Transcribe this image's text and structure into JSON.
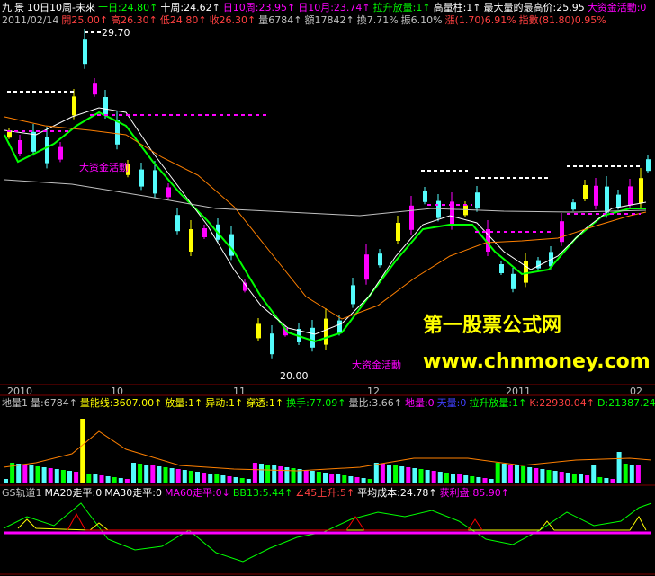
{
  "header": {
    "row1": [
      {
        "text": "九",
        "color": "#ffffff"
      },
      {
        "text": "景",
        "color": "#ffffff"
      },
      {
        "text": "10日10周-未來",
        "color": "#ffffff"
      },
      {
        "text": "十日:24.80↑",
        "color": "#00ff00"
      },
      {
        "text": "十周:24.62↑",
        "color": "#ffffff"
      },
      {
        "text": "日10周:23.95↑",
        "color": "#ff00ff"
      },
      {
        "text": "日10月:23.74↑",
        "color": "#ff00ff"
      },
      {
        "text": "拉升放量:1↑",
        "color": "#00ff00"
      },
      {
        "text": "高量柱:1↑",
        "color": "#ffffff"
      },
      {
        "text": "最大量的最高价:25.95",
        "color": "#ffffff"
      },
      {
        "text": "大资金活動:0",
        "color": "#ff00ff"
      }
    ],
    "row2": [
      {
        "text": "2011/02/14",
        "color": "#c0c0c0"
      },
      {
        "text": "開25.00↑",
        "color": "#ff4040"
      },
      {
        "text": "高26.30↑",
        "color": "#ff4040"
      },
      {
        "text": "低24.80↑",
        "color": "#ff4040"
      },
      {
        "text": "收26.30↑",
        "color": "#ff4040"
      },
      {
        "text": "量6784↑",
        "color": "#c0c0c0"
      },
      {
        "text": "額17842↑",
        "color": "#c0c0c0"
      },
      {
        "text": "換7.71%",
        "color": "#c0c0c0"
      },
      {
        "text": "振6.10%",
        "color": "#c0c0c0"
      },
      {
        "text": "漲(1.70)6.91%",
        "color": "#ff4040"
      },
      {
        "text": "指數(81.80)0.95%",
        "color": "#ff4040"
      }
    ]
  },
  "price_labels": {
    "high": "29.70",
    "low": "20.00",
    "activity1": "大资金活動",
    "activity2": "大资金活動"
  },
  "watermark": {
    "title": "第一股票公式网",
    "url": "www.chnmoney.com"
  },
  "time_axis": [
    "2010",
    "10",
    "11",
    "12",
    "2011",
    "02"
  ],
  "volume_header": [
    {
      "text": "地量1",
      "color": "#c0c0c0"
    },
    {
      "text": "量:6784↑",
      "color": "#c0c0c0"
    },
    {
      "text": "量能线:3607.00↑",
      "color": "#ffff00"
    },
    {
      "text": "放量:1↑",
      "color": "#ffff00"
    },
    {
      "text": "异动:1↑",
      "color": "#ffff00"
    },
    {
      "text": "穿透:1↑",
      "color": "#ffff00"
    },
    {
      "text": "换手:77.09↑",
      "color": "#00ff00"
    },
    {
      "text": "量比:3.66↑",
      "color": "#c0c0c0"
    },
    {
      "text": "地量:0",
      "color": "#ff00ff"
    },
    {
      "text": "天量:0",
      "color": "#4040ff"
    },
    {
      "text": "拉升放量:1↑",
      "color": "#00ff00"
    },
    {
      "text": "K:22930.04↑",
      "color": "#ff4040"
    },
    {
      "text": "D:21387.24↑",
      "color": "#00ff00"
    }
  ],
  "indicator_header": [
    {
      "text": "GS轨道1",
      "color": "#c0c0c0"
    },
    {
      "text": "MA20走平:0",
      "color": "#ffffff"
    },
    {
      "text": "MA30走平:0",
      "color": "#ffffff"
    },
    {
      "text": "MA60走平:0↓",
      "color": "#ff00ff"
    },
    {
      "text": "BB13:5.44↑",
      "color": "#00ff00"
    },
    {
      "text": "∠45上升:5↑",
      "color": "#ff4040"
    },
    {
      "text": "平均成本:24.78↑",
      "color": "#ffffff"
    },
    {
      "text": "获利盘:85.90↑",
      "color": "#ff00ff"
    }
  ],
  "colors": {
    "background": "#000000",
    "panel_border": "#800000",
    "up_candle": "#ff00ff",
    "down_candle": "#54fcfc",
    "ma_green": "#00ff00",
    "ma_white": "#ffffff",
    "ma_orange": "#ff8000",
    "dash_white": "#ffffff",
    "dash_magenta": "#ff00ff"
  }
}
